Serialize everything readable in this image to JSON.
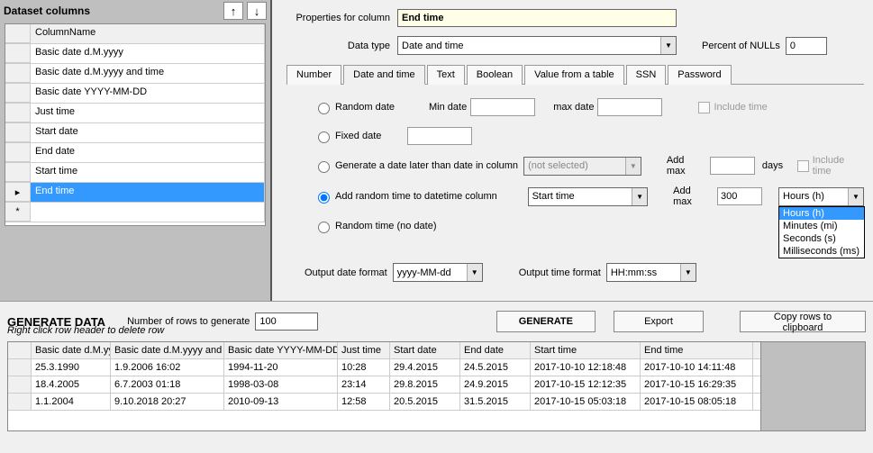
{
  "leftPanel": {
    "title": "Dataset columns",
    "colHeader": "ColumnName",
    "rows": [
      "Basic date d.M.yyyy",
      "Basic date d.M.yyyy and time",
      "Basic date YYYY-MM-DD",
      "Just time",
      "Start date",
      "End date",
      "Start time",
      "End time"
    ],
    "hint": "Right click row header to delete row"
  },
  "props": {
    "propertiesLabel": "Properties for column",
    "columnName": "End time",
    "dataTypeLabel": "Data type",
    "dataType": "Date and time",
    "nullLabel": "Percent of NULLs",
    "nullValue": "0"
  },
  "tabs": [
    "Number",
    "Date and time",
    "Text",
    "Boolean",
    "Value from a table",
    "SSN",
    "Password"
  ],
  "options": {
    "randomDate": "Random date",
    "minDate": "Min date",
    "maxDate": "max date",
    "includeTime": "Include time",
    "fixedDate": "Fixed date",
    "laterThan": "Generate a date later than date in column",
    "notSelected": "(not selected)",
    "addMax": "Add max",
    "days": "days",
    "addRandom": "Add random time to datetime column",
    "startTimeSel": "Start time",
    "addMax2": "300",
    "unit": "Hours (h)",
    "unitOptions": [
      "Hours (h)",
      "Minutes (mi)",
      "Seconds (s)",
      "Milliseconds (ms)"
    ],
    "randomTimeOnly": "Random time (no date)"
  },
  "output": {
    "dateFmtLabel": "Output date format",
    "dateFmt": "yyyy-MM-dd",
    "timeFmtLabel": "Output time format",
    "timeFmt": "HH:mm:ss"
  },
  "genSection": {
    "title": "GENERATE DATA",
    "numRowsLabel": "Number of rows to generate",
    "numRows": "100",
    "generateBtn": "GENERATE",
    "exportBtn": "Export",
    "copyBtn": "Copy rows to clipboard"
  },
  "dataGrid": {
    "headers": [
      "Basic date d.M.yyyy",
      "Basic date d.M.yyyy and time",
      "Basic date YYYY-MM-DD",
      "Just time",
      "Start date",
      "End date",
      "Start time",
      "End time"
    ],
    "rows": [
      [
        "25.3.1990",
        "1.9.2006 16:02",
        "1994-11-20",
        "10:28",
        "29.4.2015",
        "24.5.2015",
        "2017-10-10 12:18:48",
        "2017-10-10 14:11:48"
      ],
      [
        "18.4.2005",
        "6.7.2003 01:18",
        "1998-03-08",
        "23:14",
        "29.8.2015",
        "24.9.2015",
        "2017-10-15 12:12:35",
        "2017-10-15 16:29:35"
      ],
      [
        "1.1.2004",
        "9.10.2018 20:27",
        "2010-09-13",
        "12:58",
        "20.5.2015",
        "31.5.2015",
        "2017-10-15 05:03:18",
        "2017-10-15 08:05:18"
      ]
    ]
  }
}
